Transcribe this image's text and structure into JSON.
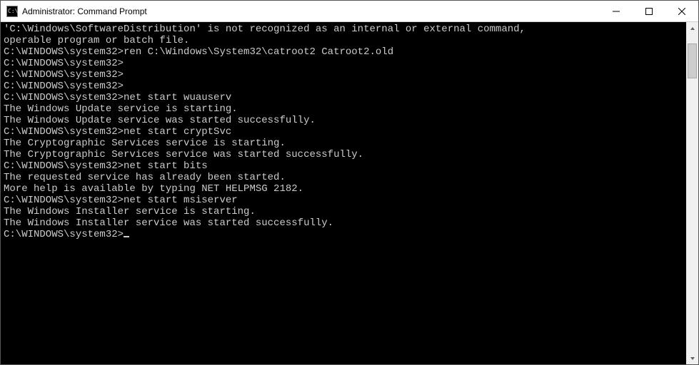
{
  "window": {
    "title": "Administrator: Command Prompt",
    "icon_name": "cmd-icon"
  },
  "terminal": {
    "prompt": "C:\\WINDOWS\\system32>",
    "lines": [
      "'C:\\Windows\\SoftwareDistribution' is not recognized as an internal or external command,",
      "operable program or batch file.",
      "",
      "C:\\WINDOWS\\system32>ren C:\\Windows\\System32\\catroot2 Catroot2.old",
      "",
      "C:\\WINDOWS\\system32>",
      "C:\\WINDOWS\\system32>",
      "C:\\WINDOWS\\system32>",
      "C:\\WINDOWS\\system32>net start wuauserv",
      "The Windows Update service is starting.",
      "The Windows Update service was started successfully.",
      "",
      "",
      "C:\\WINDOWS\\system32>net start cryptSvc",
      "The Cryptographic Services service is starting.",
      "The Cryptographic Services service was started successfully.",
      "",
      "",
      "C:\\WINDOWS\\system32>net start bits",
      "The requested service has already been started.",
      "",
      "More help is available by typing NET HELPMSG 2182.",
      "",
      "",
      "C:\\WINDOWS\\system32>net start msiserver",
      "The Windows Installer service is starting.",
      "The Windows Installer service was started successfully.",
      "",
      "",
      "C:\\WINDOWS\\system32>"
    ]
  },
  "scrollbar": {
    "thumb_top_pct": 3,
    "thumb_height_pct": 11
  }
}
